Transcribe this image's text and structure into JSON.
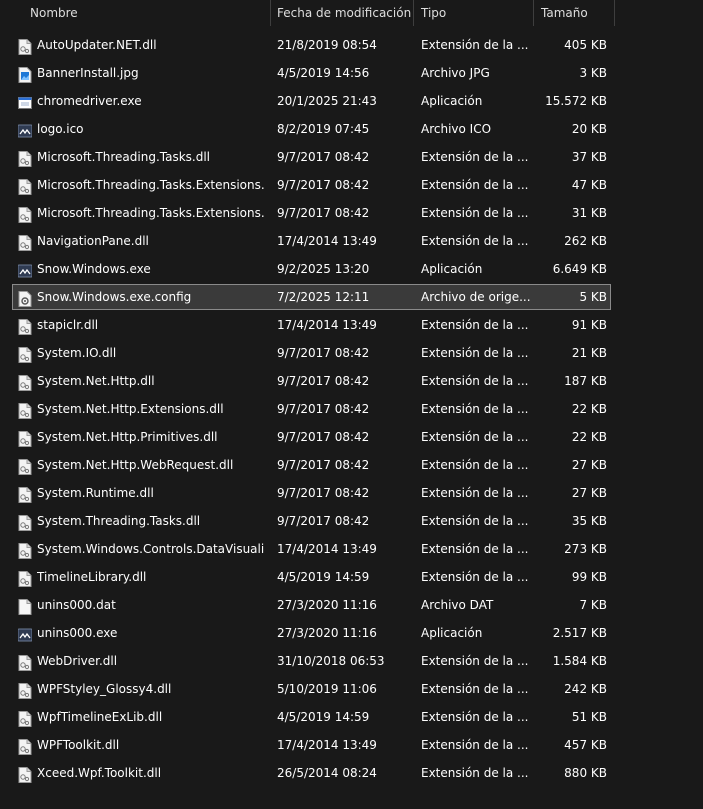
{
  "header": {
    "name": "Nombre",
    "modified": "Fecha de modificación",
    "type": "Tipo",
    "size": "Tamaño"
  },
  "files": [
    {
      "name": "AutoUpdater.NET.dll",
      "date": "21/8/2019 08:54",
      "type": "Extensión de la ...",
      "size": "405 KB",
      "icon": "dll-file-icon"
    },
    {
      "name": "BannerInstall.jpg",
      "date": "4/5/2019 14:56",
      "type": "Archivo JPG",
      "size": "3 KB",
      "icon": "image-file-icon"
    },
    {
      "name": "chromedriver.exe",
      "date": "20/1/2025 21:43",
      "type": "Aplicación",
      "size": "15.572 KB",
      "icon": "application-icon"
    },
    {
      "name": "logo.ico",
      "date": "8/2/2019 07:45",
      "type": "Archivo ICO",
      "size": "20 KB",
      "icon": "snow-logo-icon"
    },
    {
      "name": "Microsoft.Threading.Tasks.dll",
      "date": "9/7/2017 08:42",
      "type": "Extensión de la ...",
      "size": "37 KB",
      "icon": "dll-file-icon"
    },
    {
      "name": "Microsoft.Threading.Tasks.Extensions...",
      "date": "9/7/2017 08:42",
      "type": "Extensión de la ...",
      "size": "47 KB",
      "icon": "dll-file-icon"
    },
    {
      "name": "Microsoft.Threading.Tasks.Extensions...",
      "date": "9/7/2017 08:42",
      "type": "Extensión de la ...",
      "size": "31 KB",
      "icon": "dll-file-icon"
    },
    {
      "name": "NavigationPane.dll",
      "date": "17/4/2014 13:49",
      "type": "Extensión de la ...",
      "size": "262 KB",
      "icon": "dll-file-icon"
    },
    {
      "name": "Snow.Windows.exe",
      "date": "9/2/2025 13:20",
      "type": "Aplicación",
      "size": "6.649 KB",
      "icon": "snow-logo-icon"
    },
    {
      "name": "Snow.Windows.exe.config",
      "date": "7/2/2025 12:11",
      "type": "Archivo de orige...",
      "size": "5 KB",
      "icon": "config-file-icon",
      "selected": true
    },
    {
      "name": "stapiclr.dll",
      "date": "17/4/2014 13:49",
      "type": "Extensión de la ...",
      "size": "91 KB",
      "icon": "dll-file-icon"
    },
    {
      "name": "System.IO.dll",
      "date": "9/7/2017 08:42",
      "type": "Extensión de la ...",
      "size": "21 KB",
      "icon": "dll-file-icon"
    },
    {
      "name": "System.Net.Http.dll",
      "date": "9/7/2017 08:42",
      "type": "Extensión de la ...",
      "size": "187 KB",
      "icon": "dll-file-icon"
    },
    {
      "name": "System.Net.Http.Extensions.dll",
      "date": "9/7/2017 08:42",
      "type": "Extensión de la ...",
      "size": "22 KB",
      "icon": "dll-file-icon"
    },
    {
      "name": "System.Net.Http.Primitives.dll",
      "date": "9/7/2017 08:42",
      "type": "Extensión de la ...",
      "size": "22 KB",
      "icon": "dll-file-icon"
    },
    {
      "name": "System.Net.Http.WebRequest.dll",
      "date": "9/7/2017 08:42",
      "type": "Extensión de la ...",
      "size": "27 KB",
      "icon": "dll-file-icon"
    },
    {
      "name": "System.Runtime.dll",
      "date": "9/7/2017 08:42",
      "type": "Extensión de la ...",
      "size": "27 KB",
      "icon": "dll-file-icon"
    },
    {
      "name": "System.Threading.Tasks.dll",
      "date": "9/7/2017 08:42",
      "type": "Extensión de la ...",
      "size": "35 KB",
      "icon": "dll-file-icon"
    },
    {
      "name": "System.Windows.Controls.DataVisuali...",
      "date": "17/4/2014 13:49",
      "type": "Extensión de la ...",
      "size": "273 KB",
      "icon": "dll-file-icon"
    },
    {
      "name": "TimelineLibrary.dll",
      "date": "4/5/2019 14:59",
      "type": "Extensión de la ...",
      "size": "99 KB",
      "icon": "dll-file-icon"
    },
    {
      "name": "unins000.dat",
      "date": "27/3/2020 11:16",
      "type": "Archivo DAT",
      "size": "7 KB",
      "icon": "blank-file-icon"
    },
    {
      "name": "unins000.exe",
      "date": "27/3/2020 11:16",
      "type": "Aplicación",
      "size": "2.517 KB",
      "icon": "snow-logo-icon"
    },
    {
      "name": "WebDriver.dll",
      "date": "31/10/2018 06:53",
      "type": "Extensión de la ...",
      "size": "1.584 KB",
      "icon": "dll-file-icon"
    },
    {
      "name": "WPFStyley_Glossy4.dll",
      "date": "5/10/2019 11:06",
      "type": "Extensión de la ...",
      "size": "242 KB",
      "icon": "dll-file-icon"
    },
    {
      "name": "WpfTimelineExLib.dll",
      "date": "4/5/2019 14:59",
      "type": "Extensión de la ...",
      "size": "51 KB",
      "icon": "dll-file-icon"
    },
    {
      "name": "WPFToolkit.dll",
      "date": "17/4/2014 13:49",
      "type": "Extensión de la ...",
      "size": "457 KB",
      "icon": "dll-file-icon"
    },
    {
      "name": "Xceed.Wpf.Toolkit.dll",
      "date": "26/5/2014 08:24",
      "type": "Extensión de la ...",
      "size": "880 KB",
      "icon": "dll-file-icon"
    }
  ],
  "colors": {
    "background": "#191919",
    "text": "#ffffff",
    "header_text": "#dedede",
    "selection_border": "#8a8a8a",
    "selection_fill": "#3a3a3a"
  }
}
